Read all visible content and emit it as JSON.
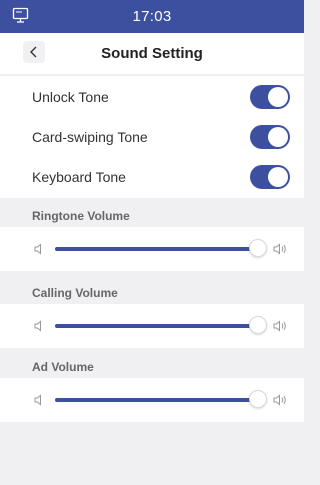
{
  "status_bar": {
    "time": "17:03",
    "icon": "monitor-icon"
  },
  "header": {
    "title": "Sound Setting",
    "back_icon": "chevron-left-icon"
  },
  "toggles": [
    {
      "label": "Unlock Tone",
      "on": true
    },
    {
      "label": "Card-swiping Tone",
      "on": true
    },
    {
      "label": "Keyboard Tone",
      "on": true
    }
  ],
  "volumes": [
    {
      "label": "Ringtone Volume",
      "level": 1.0
    },
    {
      "label": "Calling Volume",
      "level": 1.0
    },
    {
      "label": "Ad Volume",
      "level": 1.0
    }
  ],
  "colors": {
    "accent": "#3d4f9f",
    "background": "#f0f0f3",
    "track": "#e0e0e6"
  },
  "icons": {
    "volume_low": "volume-low-icon",
    "volume_high": "volume-high-icon"
  }
}
